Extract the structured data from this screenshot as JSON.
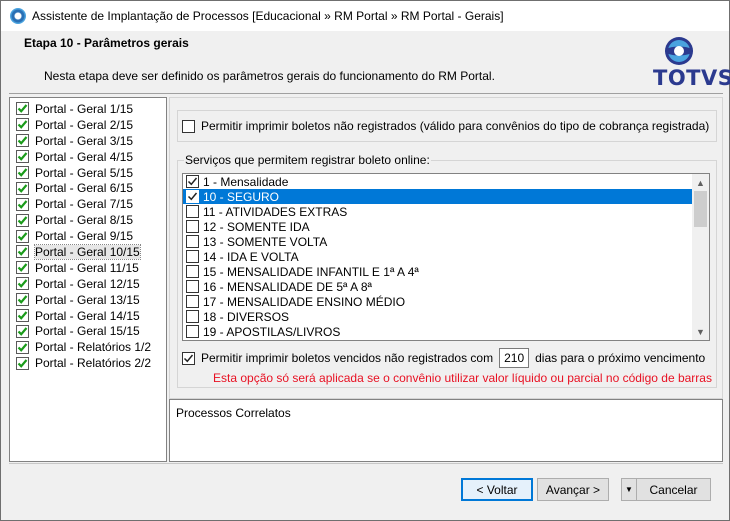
{
  "window": {
    "title": "Assistente de Implantação de Processos [Educacional » RM Portal » RM Portal - Gerais]"
  },
  "header": {
    "step_title": "Etapa 10 - Parâmetros gerais",
    "step_description": "Nesta etapa deve ser definido os parâmetros gerais do funcionamento do RM Portal.",
    "logo_text": "TOTVS",
    "brand_colors": {
      "logo_blue": "#2b3a8f",
      "logo_light": "#4aa3df"
    }
  },
  "steps": [
    {
      "label": "Portal - Geral 1/15",
      "checked": true
    },
    {
      "label": "Portal - Geral 2/15",
      "checked": true
    },
    {
      "label": "Portal - Geral 3/15",
      "checked": true
    },
    {
      "label": "Portal - Geral 4/15",
      "checked": true
    },
    {
      "label": "Portal - Geral 5/15",
      "checked": true
    },
    {
      "label": "Portal - Geral 6/15",
      "checked": true
    },
    {
      "label": "Portal - Geral 7/15",
      "checked": true
    },
    {
      "label": "Portal - Geral 8/15",
      "checked": true
    },
    {
      "label": "Portal - Geral 9/15",
      "checked": true
    },
    {
      "label": "Portal - Geral 10/15",
      "checked": true,
      "selected": true
    },
    {
      "label": "Portal - Geral 11/15",
      "checked": true
    },
    {
      "label": "Portal - Geral 12/15",
      "checked": true
    },
    {
      "label": "Portal - Geral 13/15",
      "checked": true
    },
    {
      "label": "Portal - Geral 14/15",
      "checked": true
    },
    {
      "label": "Portal - Geral 15/15",
      "checked": true
    },
    {
      "label": "Portal - Relatórios 1/2",
      "checked": true
    },
    {
      "label": "Portal - Relatórios 2/2",
      "checked": true
    }
  ],
  "options": {
    "print_unregistered": {
      "label": "Permitir imprimir boletos não registrados (válido para convênios do tipo de cobrança registrada)",
      "checked": false
    },
    "services_group_label": "Serviços que permitem registrar boleto online:",
    "services": [
      {
        "label": "1 - Mensalidade",
        "checked": true
      },
      {
        "label": "10 - SEGURO",
        "checked": true,
        "selected": true
      },
      {
        "label": "11 - ATIVIDADES EXTRAS",
        "checked": false
      },
      {
        "label": "12 - SOMENTE IDA",
        "checked": false
      },
      {
        "label": "13 - SOMENTE VOLTA",
        "checked": false
      },
      {
        "label": "14 - IDA E VOLTA",
        "checked": false
      },
      {
        "label": "15 - MENSALIDADE INFANTIL E 1ª A 4ª",
        "checked": false
      },
      {
        "label": "16 - MENSALIDADE DE 5ª A 8ª",
        "checked": false
      },
      {
        "label": "17 - MENSALIDADE ENSINO MÉDIO",
        "checked": false
      },
      {
        "label": "18 - DIVERSOS",
        "checked": false
      },
      {
        "label": "19 - APOSTILAS/LIVROS",
        "checked": false
      }
    ],
    "print_overdue": {
      "label_before": "Permitir imprimir boletos vencidos não registrados com",
      "days_value": "210",
      "label_after": "dias para o próximo vencimento",
      "checked": true
    },
    "warning": "Esta opção só será aplicada se o convênio utilizar valor líquido ou parcial no código de barras",
    "warning_color": "#e81123"
  },
  "related": {
    "title": "Processos Correlatos"
  },
  "buttons": {
    "back": "< Voltar",
    "next": "Avançar >",
    "cancel": "Cancelar"
  }
}
